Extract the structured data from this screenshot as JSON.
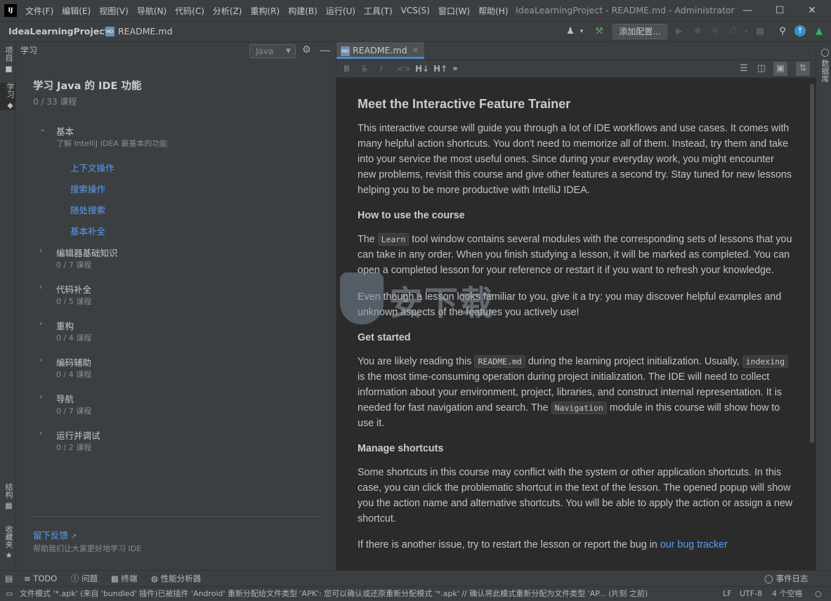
{
  "app": {
    "logo": "IJ",
    "window_title": "IdeaLearningProject - README.md - Administrator",
    "menu": [
      "文件(F)",
      "编辑(E)",
      "视图(V)",
      "导航(N)",
      "代码(C)",
      "分析(Z)",
      "重构(R)",
      "构建(B)",
      "运行(U)",
      "工具(T)",
      "VCS(S)",
      "窗口(W)",
      "帮助(H)"
    ]
  },
  "navbar": {
    "project": "IdeaLearningProject",
    "file": "README.md",
    "add_config": "添加配置..."
  },
  "left_stripe": {
    "project": "项目",
    "learn": "学习",
    "structure": "结构",
    "favorites": "收藏夹"
  },
  "right_stripe": {
    "database": "数据库"
  },
  "learn_panel": {
    "header": "学习",
    "language": "Java",
    "course_title": "学习 Java 的 IDE 功能",
    "course_progress": "0 / 33 课程",
    "modules": [
      {
        "name": "基本",
        "desc": "了解 IntelliJ IDEA 最基本的功能",
        "lessons": [
          "上下文操作",
          "搜索操作",
          "随处搜索",
          "基本补全"
        ]
      },
      {
        "name": "编辑器基础知识",
        "desc": "0 / 7 课程"
      },
      {
        "name": "代码补全",
        "desc": "0 / 5 课程"
      },
      {
        "name": "重构",
        "desc": "0 / 4 课程"
      },
      {
        "name": "编码辅助",
        "desc": "0 / 4 课程"
      },
      {
        "name": "导航",
        "desc": "0 / 7 课程"
      },
      {
        "name": "运行并调试",
        "desc": "0 / 2 课程"
      }
    ],
    "feedback_link": "留下反馈",
    "feedback_help": "帮助我们让大家更好地学习 IDE"
  },
  "editor": {
    "tab": "README.md",
    "md_toolbar": [
      "B",
      "S",
      "I",
      "<>",
      "H↓",
      "H↑"
    ],
    "doc": {
      "h1": "Meet the Interactive Feature Trainer",
      "p1": "This interactive course will guide you through a lot of IDE workflows and use cases. It comes with many helpful action shortcuts. You don't need to memorize all of them. Instead, try them and take into your service the most useful ones. Since during your everyday work, you might encounter new problems, revisit this course and give other features a second try. Stay tuned for new lessons helping you to be more productive with IntelliJ IDEA.",
      "h2": "How to use the course",
      "p2a": "The",
      "code_learn": "Learn",
      "p2b": "tool window contains several modules with the corresponding sets of lessons that you can take in any order. When you finish studying a lesson, it will be marked as completed. You can open a completed lesson for your reference or restart it if you want to refresh your knowledge.",
      "p3": "Even though a lesson looks familiar to you, give it a try: you may discover helpful examples and unknown aspects of the features you actively use!",
      "h3": "Get started",
      "p4a": "You are likely reading this",
      "code_readme": "README.md",
      "p4b": "during the learning project initialization. Usually,",
      "code_indexing": "indexing",
      "p4c": "is the most time-consuming operation during project initialization. The IDE will need to collect information about your environment, project, libraries, and construct internal representation. It is needed for fast navigation and search. The",
      "code_navigation": "Navigation",
      "p4d": "module in this course will show how to use it.",
      "h4": "Manage shortcuts",
      "p5": "Some shortcuts in this course may conflict with the system or other application shortcuts. In this case, you can click the problematic shortcut in the text of the lesson. The opened popup will show you the action name and alternative shortcuts. You will be able to apply the action or assign a new shortcut.",
      "p6a": "If there is another issue, try to restart the lesson or report the bug in",
      "p6_link": "our bug tracker"
    }
  },
  "watermark": "安下载",
  "tool_windows": [
    "TODO",
    "问题",
    "终端",
    "性能分析器"
  ],
  "event_log": "事件日志",
  "status": {
    "message": "文件模式 '*.apk' (来自 'bundled' 插件)已被插件 'Android' 重新分配给文件类型 'APK': 您可以确认或还原重新分配模式 '*.apk' // 确认将此模式重新分配为文件类型 'AP... (片刻 之前)",
    "line_sep": "LF",
    "encoding": "UTF-8",
    "indent": "4 个空格"
  }
}
